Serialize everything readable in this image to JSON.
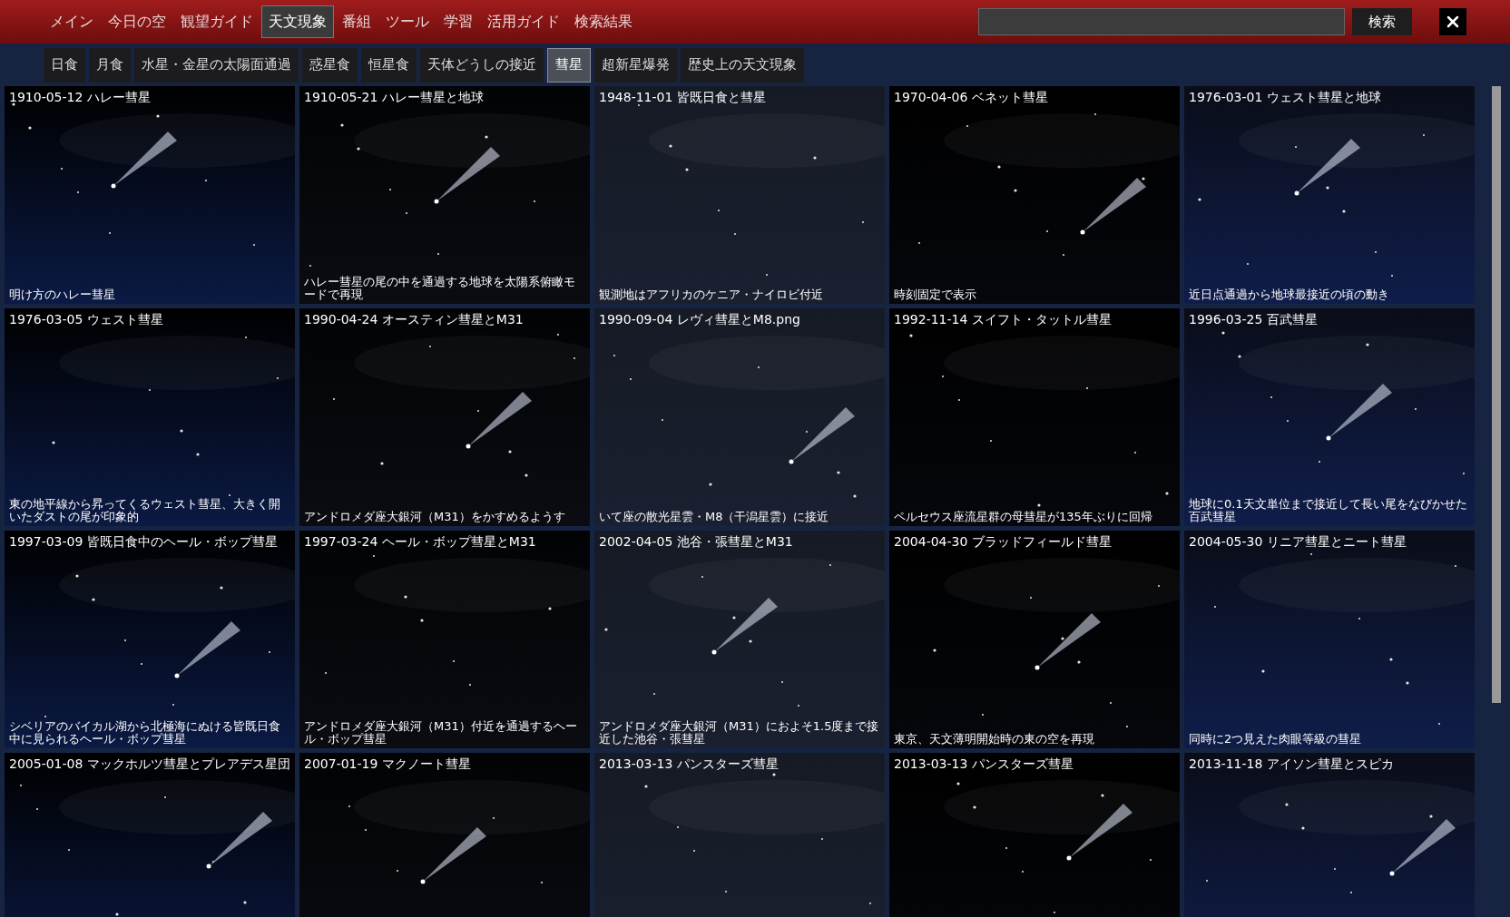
{
  "nav": [
    {
      "label": "メイン",
      "selected": false
    },
    {
      "label": "今日の空",
      "selected": false
    },
    {
      "label": "観望ガイド",
      "selected": false
    },
    {
      "label": "天文現象",
      "selected": true
    },
    {
      "label": "番組",
      "selected": false
    },
    {
      "label": "ツール",
      "selected": false
    },
    {
      "label": "学習",
      "selected": false
    },
    {
      "label": "活用ガイド",
      "selected": false
    },
    {
      "label": "検索結果",
      "selected": false
    }
  ],
  "search": {
    "button": "検索"
  },
  "subnav": [
    {
      "label": "日食",
      "selected": false
    },
    {
      "label": "月食",
      "selected": false
    },
    {
      "label": "水星・金星の太陽面通過",
      "selected": false
    },
    {
      "label": "惑星食",
      "selected": false
    },
    {
      "label": "恒星食",
      "selected": false
    },
    {
      "label": "天体どうしの接近",
      "selected": false
    },
    {
      "label": "彗星",
      "selected": true
    },
    {
      "label": "超新星爆発",
      "selected": false
    },
    {
      "label": "歴史上の天文現象",
      "selected": false
    }
  ],
  "tiles": [
    {
      "title": "1910-05-12 ハレー彗星",
      "caption": "明け方のハレー彗星"
    },
    {
      "title": "1910-05-21 ハレー彗星と地球",
      "caption": "ハレー彗星の尾の中を通過する地球を太陽系俯瞰モードで再現"
    },
    {
      "title": "1948-11-01 皆既日食と彗星",
      "caption": "観測地はアフリカのケニア・ナイロビ付近"
    },
    {
      "title": "1970-04-06 ベネット彗星",
      "caption": "時刻固定で表示"
    },
    {
      "title": "1976-03-01 ウェスト彗星と地球",
      "caption": "近日点通過から地球最接近の頃の動き"
    },
    {
      "title": "1976-03-05 ウェスト彗星",
      "caption": "東の地平線から昇ってくるウェスト彗星、大きく開いたダストの尾が印象的"
    },
    {
      "title": "1990-04-24 オースティン彗星とM31",
      "caption": "アンドロメダ座大銀河（M31）をかすめるようす"
    },
    {
      "title": "1990-09-04 レヴィ彗星とM8.png",
      "caption": "いて座の散光星雲・M8（干潟星雲）に接近"
    },
    {
      "title": "1992-11-14 スイフト・タットル彗星",
      "caption": "ペルセウス座流星群の母彗星が135年ぶりに回帰"
    },
    {
      "title": "1996-03-25 百武彗星",
      "caption": "地球に0.1天文単位まで接近して長い尾をなびかせた百武彗星"
    },
    {
      "title": "1997-03-09 皆既日食中のヘール・ボップ彗星",
      "caption": "シベリアのバイカル湖から北極海にぬける皆既日食中に見られるヘール・ボップ彗星"
    },
    {
      "title": "1997-03-24 ヘール・ボップ彗星とM31",
      "caption": "アンドロメダ座大銀河（M31）付近を通過するヘール・ボップ彗星"
    },
    {
      "title": "2002-04-05 池谷・張彗星とM31",
      "caption": "アンドロメダ座大銀河（M31）におよそ1.5度まで接近した池谷・張彗星"
    },
    {
      "title": "2004-04-30 ブラッドフィールド彗星",
      "caption": "東京、天文薄明開始時の東の空を再現"
    },
    {
      "title": "2004-05-30 リニア彗星とニート彗星",
      "caption": "同時に2つ見えた肉眼等級の彗星"
    },
    {
      "title": "2005-01-08 マックホルツ彗星とプレアデス星団"
    },
    {
      "title": "2007-01-19 マクノート彗星"
    },
    {
      "title": "2013-03-13 パンスターズ彗星"
    },
    {
      "title": "2013-03-13 パンスターズ彗星"
    },
    {
      "title": "2013-11-18 アイソン彗星とスピカ"
    }
  ]
}
